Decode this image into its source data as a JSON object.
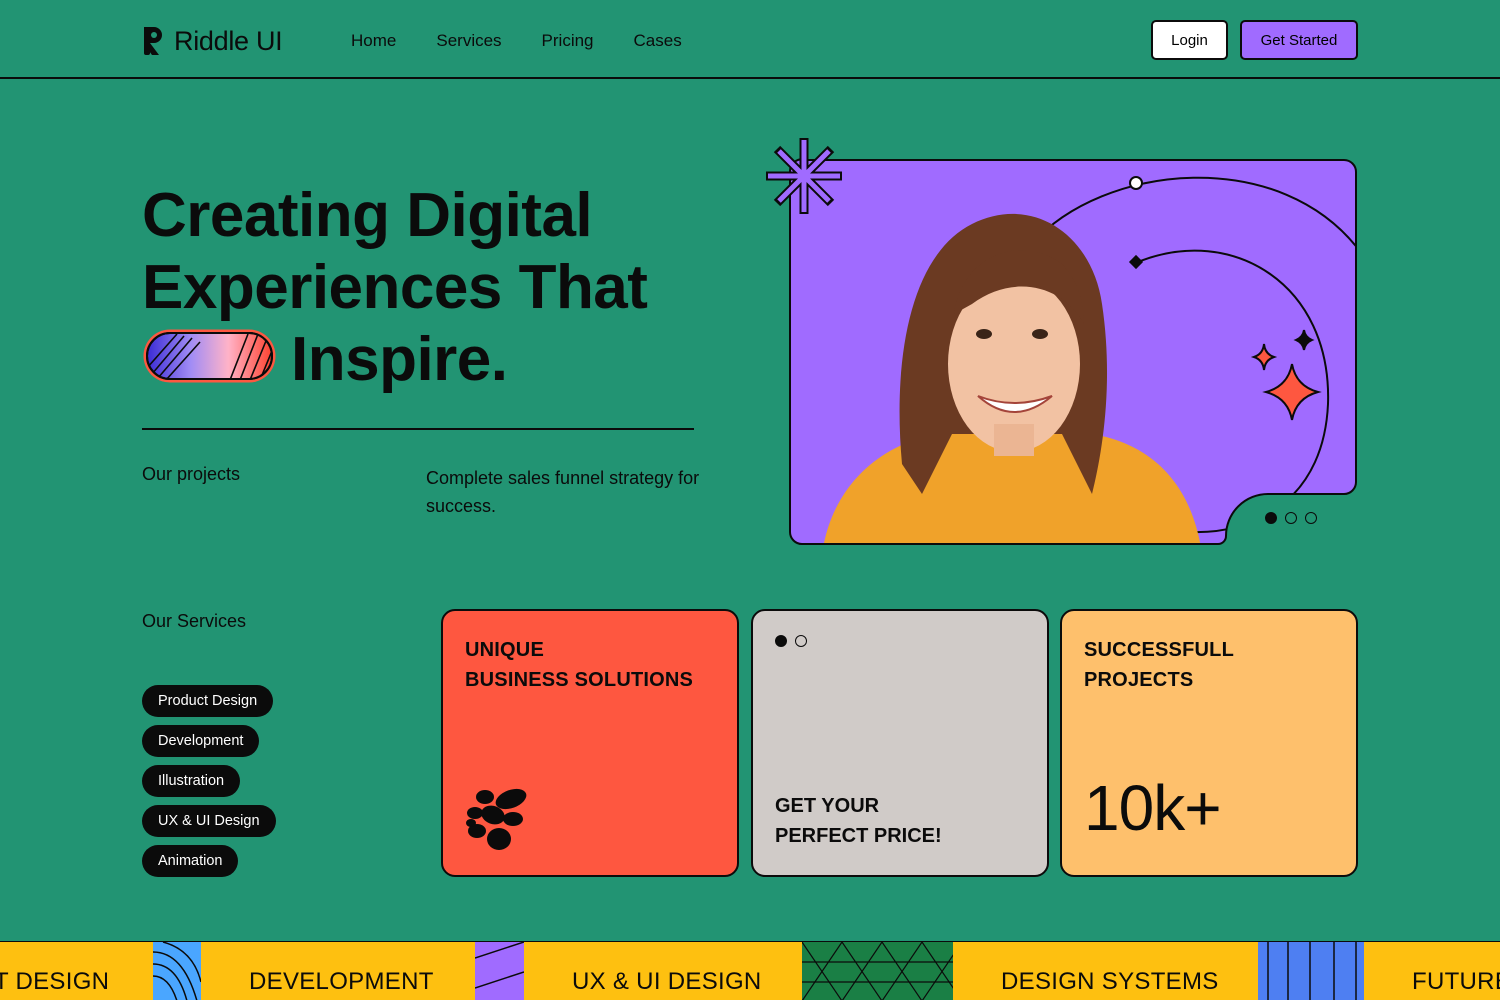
{
  "header": {
    "logo_text": "Riddle UI",
    "nav": [
      {
        "label": "Home"
      },
      {
        "label": "Services"
      },
      {
        "label": "Pricing"
      },
      {
        "label": "Cases"
      }
    ],
    "login_label": "Login",
    "get_started_label": "Get Started"
  },
  "hero": {
    "title_line1": "Creating Digital",
    "title_line2": "Experiences That",
    "title_line3": "Inspire.",
    "projects_label": "Our projects",
    "description": "Complete sales funnel strategy for success.",
    "carousel": {
      "total": 3,
      "active": 1
    }
  },
  "services": {
    "label": "Our Services",
    "tags": [
      {
        "label": "Product Design"
      },
      {
        "label": "Development"
      },
      {
        "label": "Illustration"
      },
      {
        "label": "UX & UI Design"
      },
      {
        "label": "Animation"
      }
    ]
  },
  "cards": {
    "card1": {
      "line1": "UNIQUE",
      "line2": "BUSINESS SOLUTIONS"
    },
    "card2": {
      "line1": "GET YOUR",
      "line2": "PERFECT PRICE!",
      "dots_total": 2,
      "dots_active": 1
    },
    "card3": {
      "line1": "SUCCESSFULL",
      "line2": "PROJECTS",
      "stat": "10k+"
    }
  },
  "marquee": {
    "items": [
      "T DESIGN",
      "DEVELOPMENT",
      "UX & UI DESIGN",
      "DESIGN SYSTEMS",
      "FUTURE"
    ]
  },
  "colors": {
    "background": "#229473",
    "accent_purple": "#a06bff",
    "accent_red": "#fe5740",
    "accent_orange": "#fec06c",
    "neutral_grey": "#d0cbc8",
    "marquee_yellow": "#fec010"
  },
  "icons": [
    "logo-mark-icon",
    "asterisk-burst-icon",
    "sparkle-star-icon",
    "blob-cluster-icon",
    "gradient-pill-icon"
  ]
}
